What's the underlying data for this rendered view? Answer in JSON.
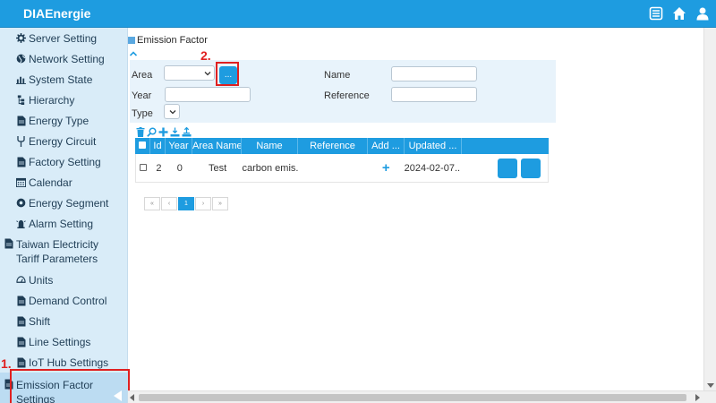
{
  "app": {
    "title": "DIAEnergie"
  },
  "colors": {
    "accent": "#1e9ce0",
    "sidebar_bg": "#d9ecf8",
    "annotation": "#e02020"
  },
  "topbar": {
    "icons": [
      "list-icon",
      "home-icon",
      "user-icon"
    ]
  },
  "sidebar": {
    "items": [
      {
        "label": "Server Setting",
        "icon": "gear-icon"
      },
      {
        "label": "Network Setting",
        "icon": "globe-icon"
      },
      {
        "label": "System State",
        "icon": "bar-chart-icon"
      },
      {
        "label": "Hierarchy",
        "icon": "hierarchy-icon"
      },
      {
        "label": "Energy Type",
        "icon": "document-icon"
      },
      {
        "label": "Energy Circuit",
        "icon": "circuit-icon"
      },
      {
        "label": "Factory Setting",
        "icon": "document-icon"
      },
      {
        "label": "Calendar",
        "icon": "calendar-icon"
      },
      {
        "label": "Energy Segment",
        "icon": "segment-icon"
      },
      {
        "label": "Alarm Setting",
        "icon": "alarm-icon"
      },
      {
        "label": "Taiwan Electricity Tariff Parameters",
        "icon": "document-icon"
      },
      {
        "label": "Units",
        "icon": "units-icon"
      },
      {
        "label": "Demand Control",
        "icon": "document-icon"
      },
      {
        "label": "Shift",
        "icon": "document-icon"
      },
      {
        "label": "Line Settings",
        "icon": "document-icon"
      },
      {
        "label": "IoT Hub Settings",
        "icon": "document-icon"
      },
      {
        "label": "Emission Factor Settings",
        "icon": "document-icon",
        "active": true
      }
    ]
  },
  "annotations": {
    "step1": "1.",
    "step2": "2."
  },
  "page": {
    "title": "Emission Factor",
    "filters": {
      "area_label": "Area",
      "area_button": "...",
      "name_label": "Name",
      "year_label": "Year",
      "reference_label": "Reference",
      "type_label": "Type"
    },
    "toolbar_icons": [
      "trash-icon",
      "search-icon",
      "add-icon",
      "import-icon",
      "export-icon"
    ],
    "grid": {
      "columns": [
        "Id",
        "Year",
        "Area Name",
        "Name",
        "Reference",
        "Add ...",
        "Updated ..."
      ],
      "rows": [
        {
          "id": "2",
          "year": "0",
          "area_name": "Test",
          "name": "carbon emis...",
          "reference": "",
          "add": "+",
          "updated": "2024-02-07..."
        }
      ]
    },
    "pager": [
      "«",
      "‹",
      "1",
      "›",
      "»"
    ]
  }
}
